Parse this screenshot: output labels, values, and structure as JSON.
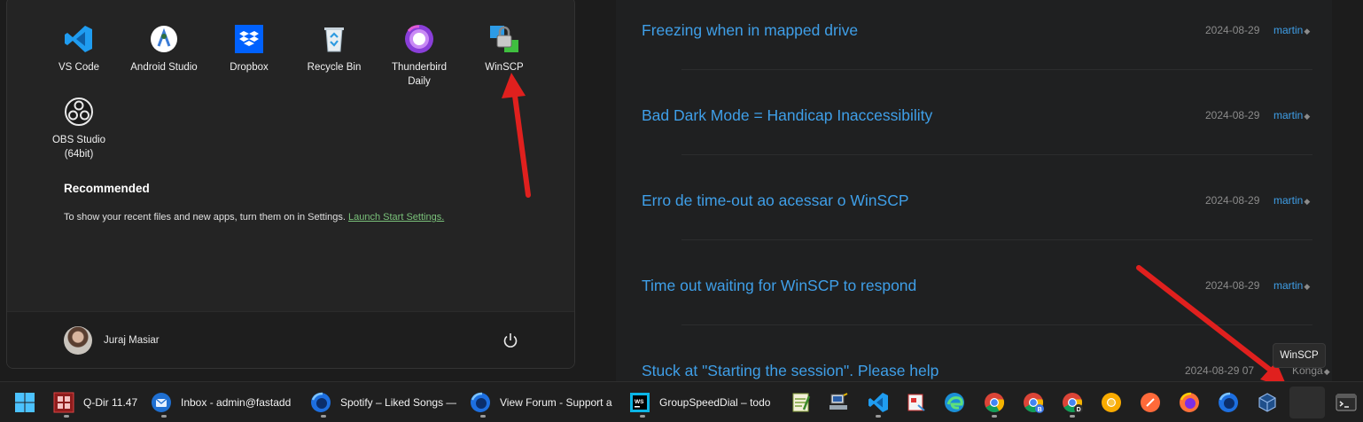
{
  "start_menu": {
    "apps": [
      {
        "label": "VS Code",
        "icon": "vscode-icon"
      },
      {
        "label": "Android Studio",
        "icon": "android-studio-icon"
      },
      {
        "label": "Dropbox",
        "icon": "dropbox-icon"
      },
      {
        "label": "Recycle Bin",
        "icon": "recycle-bin-icon"
      },
      {
        "label": "Thunderbird\nDaily",
        "icon": "thunderbird-icon"
      },
      {
        "label": "WinSCP",
        "icon": "winscp-icon"
      },
      {
        "label": "OBS Studio\n(64bit)",
        "icon": "obs-icon"
      }
    ],
    "recommended": {
      "title": "Recommended",
      "text": "To show your recent files and new apps, turn them on in Settings. ",
      "link": "Launch Start Settings."
    },
    "user": {
      "name": "Juraj Masiar"
    }
  },
  "forum": {
    "topics": [
      {
        "title": "Freezing when in mapped drive",
        "date": "2024-08-29",
        "user": "martin"
      },
      {
        "title": "Bad Dark Mode = Handicap Inaccessibility",
        "date": "2024-08-29",
        "user": "martin"
      },
      {
        "title": "Erro de time-out ao acessar o WinSCP",
        "date": "2024-08-29",
        "user": "martin"
      },
      {
        "title": "Time out waiting for WinSCP to respond",
        "date": "2024-08-29",
        "user": "martin"
      },
      {
        "title": "Stuck at \"Starting the session\". Please help",
        "date": "2024-08-29 07",
        "user": "Konga"
      }
    ]
  },
  "tooltip": "WinSCP",
  "taskbar": {
    "items": [
      {
        "label": "Q-Dir 11.47",
        "icon": "qdir-icon"
      },
      {
        "label": "Inbox - admin@fastadd",
        "icon": "thunderbird-icon"
      },
      {
        "label": "Spotify – Liked Songs —",
        "icon": "firefox-dev-icon"
      },
      {
        "label": "View Forum - Support a",
        "icon": "firefox-dev-icon"
      },
      {
        "label": "GroupSpeedDial – todo",
        "icon": "webstorm-icon"
      }
    ]
  },
  "colors": {
    "link": "#3f9fe8",
    "arrow": "#e0201e",
    "settings_link": "#7ac27a"
  }
}
